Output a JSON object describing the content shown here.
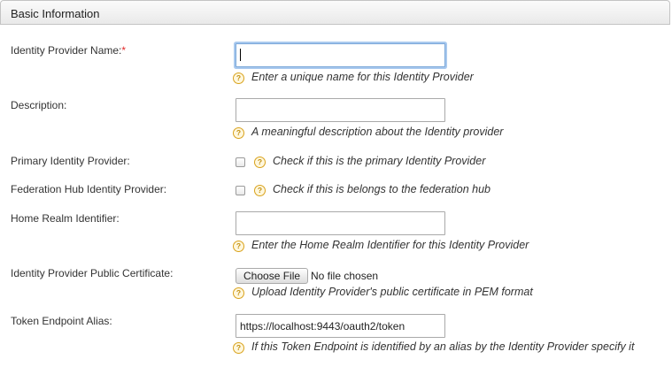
{
  "panel": {
    "title": "Basic Information"
  },
  "fields": {
    "idp_name": {
      "label": "Identity Provider Name:",
      "required_mark": "*",
      "value": "",
      "help": "Enter a unique name for this Identity Provider"
    },
    "description": {
      "label": "Description:",
      "value": "",
      "help": "A meaningful description about the Identity provider"
    },
    "primary": {
      "label": "Primary Identity Provider:",
      "checked": false,
      "help": "Check if this is the primary Identity Provider"
    },
    "federation_hub": {
      "label": "Federation Hub Identity Provider:",
      "checked": false,
      "help": "Check if this is belongs to the federation hub"
    },
    "home_realm": {
      "label": "Home Realm Identifier:",
      "value": "",
      "help": "Enter the Home Realm Identifier for this Identity Provider"
    },
    "public_cert": {
      "label": "Identity Provider Public Certificate:",
      "button_label": "Choose File",
      "file_status": "No file chosen",
      "help": "Upload Identity Provider's public certificate in PEM format"
    },
    "token_alias": {
      "label": "Token Endpoint Alias:",
      "value": "https://localhost:9443/oauth2/token",
      "help": "If this Token Endpoint is identified by an alias by the Identity Provider specify it"
    }
  },
  "icons": {
    "help": "help-question-icon",
    "help_glyph": "?"
  },
  "colors": {
    "required": "#e32a2a",
    "focus": "#7aa7d9",
    "help_icon": "#d9a21c"
  }
}
